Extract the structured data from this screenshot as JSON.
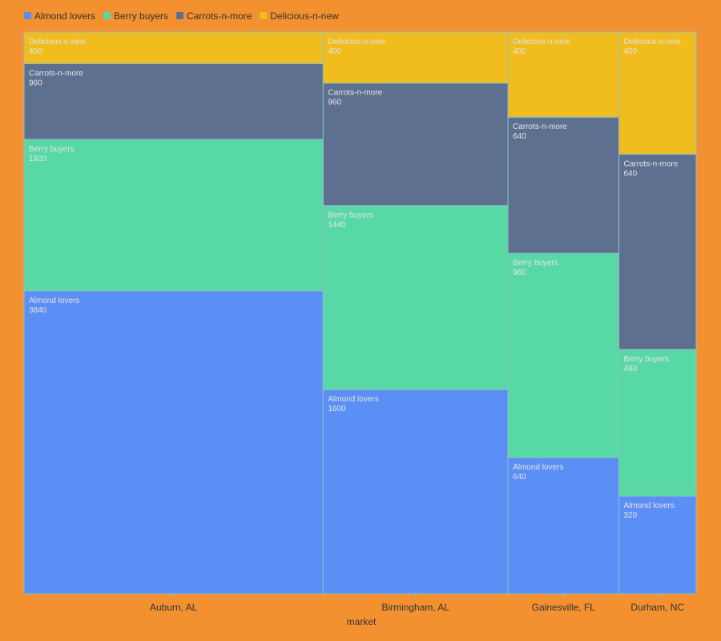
{
  "chart_data": {
    "type": "marimekko",
    "xlabel": "market",
    "legend_position": "top-left",
    "categories": [
      "Auburn, AL",
      "Birmingham, AL",
      "Gainesville, FL",
      "Durham, NC"
    ],
    "series": [
      {
        "name": "Almond lovers",
        "color": "#5b8ff5",
        "values": [
          3840,
          1600,
          640,
          320
        ]
      },
      {
        "name": "Berry buyers",
        "color": "#58d8a4",
        "values": [
          1920,
          1440,
          960,
          480
        ]
      },
      {
        "name": "Carrots-n-more",
        "color": "#5d7090",
        "values": [
          960,
          960,
          640,
          640
        ]
      },
      {
        "name": "Delicious-n-new",
        "color": "#f0bc1e",
        "values": [
          400,
          400,
          400,
          400
        ]
      }
    ],
    "background": "#f39130",
    "border_color": "#8fc0c4",
    "label_color": "#e4e4e4",
    "text_color": "#333333"
  }
}
